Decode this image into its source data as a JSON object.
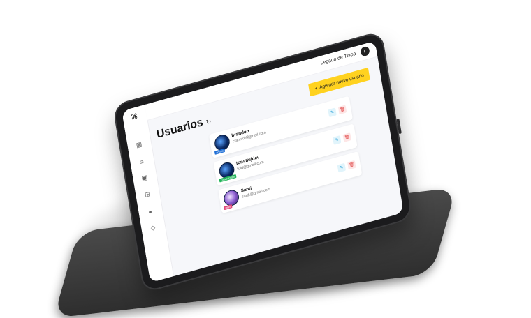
{
  "app": {
    "user_name": "Legado de Tlapa",
    "user_initial": "L"
  },
  "sidebar": {
    "items": [
      {
        "icon": "logo-icon",
        "glyph": "⌘"
      },
      {
        "icon": "grid-icon",
        "glyph": "▦"
      },
      {
        "icon": "layers-icon",
        "glyph": "≡"
      },
      {
        "icon": "image-icon",
        "glyph": "▣"
      },
      {
        "icon": "table-icon",
        "glyph": "⊞"
      },
      {
        "icon": "user-icon",
        "glyph": "●"
      },
      {
        "icon": "tag-icon",
        "glyph": "◇"
      }
    ]
  },
  "main": {
    "title": "Usuarios",
    "refresh_glyph": "↻",
    "add_button_label": "Agregar nuevo usuario",
    "add_button_glyph": "+"
  },
  "users": [
    {
      "name": "brandon",
      "email": "cranlsdl@gmail.com",
      "role": "admin",
      "role_color": "#1f6fd6",
      "avatar": "blue"
    },
    {
      "name": "tonatiujdev",
      "email": "fuid@gmail.com",
      "role": "colaborador",
      "role_color": "#22b55a",
      "avatar": "blue"
    },
    {
      "name": "Santi",
      "email": "sardl@gmail.com",
      "role": "user",
      "role_color": "#e04a7a",
      "avatar": "purple"
    }
  ],
  "actions": {
    "edit_glyph": "✎",
    "delete_glyph": "🗑"
  },
  "colors": {
    "accent_yellow": "#ffd21f",
    "edit_blue": "#1a9ad6",
    "delete_red": "#e04444"
  }
}
